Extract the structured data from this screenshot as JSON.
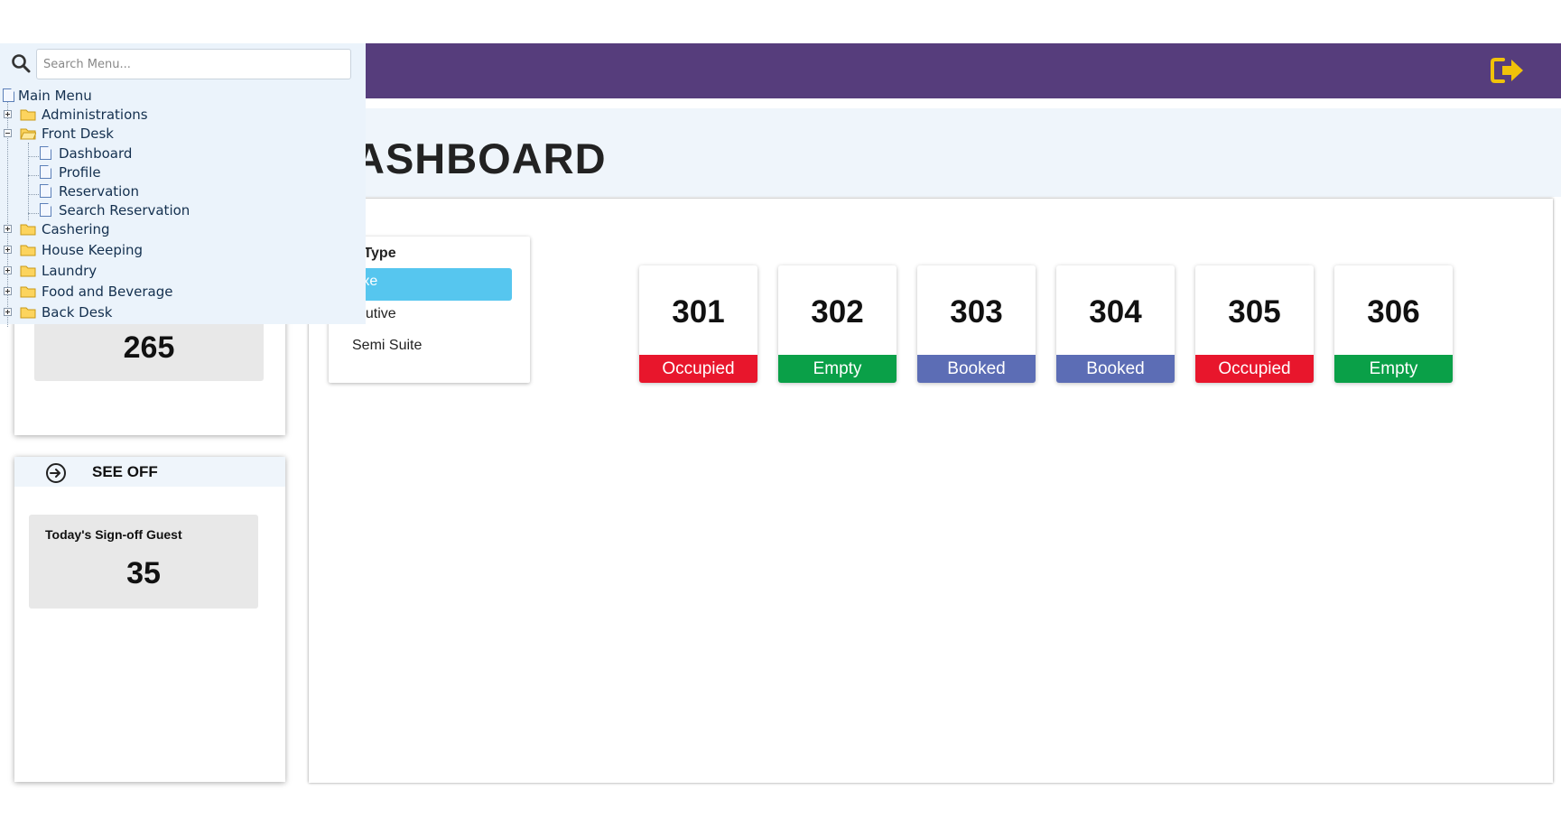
{
  "header": {
    "title": "ASHBOARD",
    "logout_icon": "logout-arrow-icon",
    "bar_color": "#563d7c",
    "icon_color": "#f0c20a"
  },
  "menu": {
    "search_placeholder": "Search Menu...",
    "root": "Main Menu",
    "items": [
      {
        "label": "Administrations",
        "type": "folder",
        "expanded": false
      },
      {
        "label": "Front Desk",
        "type": "folder",
        "expanded": true,
        "children": [
          "Dashboard",
          "Profile",
          "Reservation",
          "Search Reservation"
        ]
      },
      {
        "label": "Cashering",
        "type": "folder",
        "expanded": false
      },
      {
        "label": "House Keeping",
        "type": "folder",
        "expanded": false
      },
      {
        "label": "Laundry",
        "type": "folder",
        "expanded": false
      },
      {
        "label": "Food and Beverage",
        "type": "folder",
        "expanded": false
      },
      {
        "label": "Back Desk",
        "type": "folder",
        "expanded": false
      }
    ]
  },
  "stats": {
    "card_a": {
      "value": "265"
    },
    "see_off": {
      "title": "SEE OFF",
      "icon": "sign-out-circle-icon",
      "label": "Today's Sign-off Guest",
      "value": "35"
    }
  },
  "room_type": {
    "title": "om Type",
    "options": [
      {
        "label": "eluxe",
        "active": true
      },
      {
        "label": "xecutive",
        "active": false
      },
      {
        "label": "Semi Suite",
        "active": false
      }
    ],
    "active_color": "#56c6ef"
  },
  "status_colors": {
    "Occupied": "#e8162c",
    "Empty": "#0aa048",
    "Booked": "#5c6db5"
  },
  "rooms": [
    {
      "number": "301",
      "status": "Occupied"
    },
    {
      "number": "302",
      "status": "Empty"
    },
    {
      "number": "303",
      "status": "Booked"
    },
    {
      "number": "304",
      "status": "Booked"
    },
    {
      "number": "305",
      "status": "Occupied"
    },
    {
      "number": "306",
      "status": "Empty"
    }
  ]
}
